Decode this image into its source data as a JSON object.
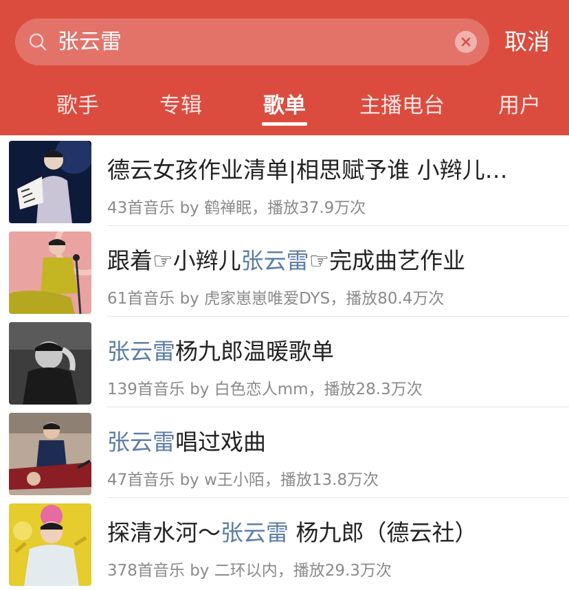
{
  "search": {
    "query": "张云雷",
    "cancel_label": "取消"
  },
  "tabs": [
    {
      "label": "歌手"
    },
    {
      "label": "专辑"
    },
    {
      "label": "歌单"
    },
    {
      "label": "主播电台"
    },
    {
      "label": "用户"
    }
  ],
  "active_tab": "歌单",
  "highlight_color": "#5c7da6",
  "accent_color": "#db4c3f",
  "playlists": [
    {
      "title_pre": "德云女孩作业清单|相思赋予谁 小辫儿…",
      "title_hl": "",
      "title_post": "",
      "meta": "43首音乐  by 鹤禅眠，播放37.9万次"
    },
    {
      "title_pre": "跟着☞小辫儿",
      "title_hl": "张云雷",
      "title_post": "☞完成曲艺作业",
      "meta": "61首音乐  by 虎家崽崽唯爱DYS，播放80.4万次"
    },
    {
      "title_pre": "",
      "title_hl": "张云雷",
      "title_post": "杨九郎温暖歌单",
      "meta": "139首音乐  by 白色恋人mm，播放28.3万次"
    },
    {
      "title_pre": "",
      "title_hl": "张云雷",
      "title_post": "唱过戏曲",
      "meta": "47首音乐  by w王小陌，播放13.8万次"
    },
    {
      "title_pre": "探清水河～",
      "title_hl": "张云雷",
      "title_post": " 杨九郎（德云社）",
      "meta": "378首音乐  by 二环以内，播放29.3万次"
    }
  ]
}
